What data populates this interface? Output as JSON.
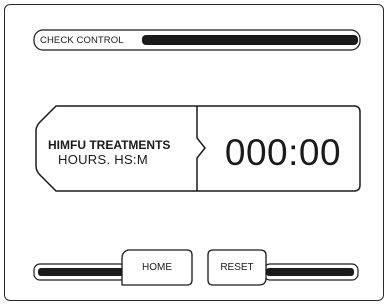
{
  "check": {
    "label": "CHECK CONTROL"
  },
  "treatments": {
    "title": "HIMFU TREATMENTS",
    "subtitle": "HOURS. HS:M",
    "timer_value": "000:00"
  },
  "buttons": {
    "home_label": "HOME",
    "reset_label": "RESET"
  },
  "colors": {
    "foreground": "#1a1a1a",
    "background": "#ffffff"
  }
}
